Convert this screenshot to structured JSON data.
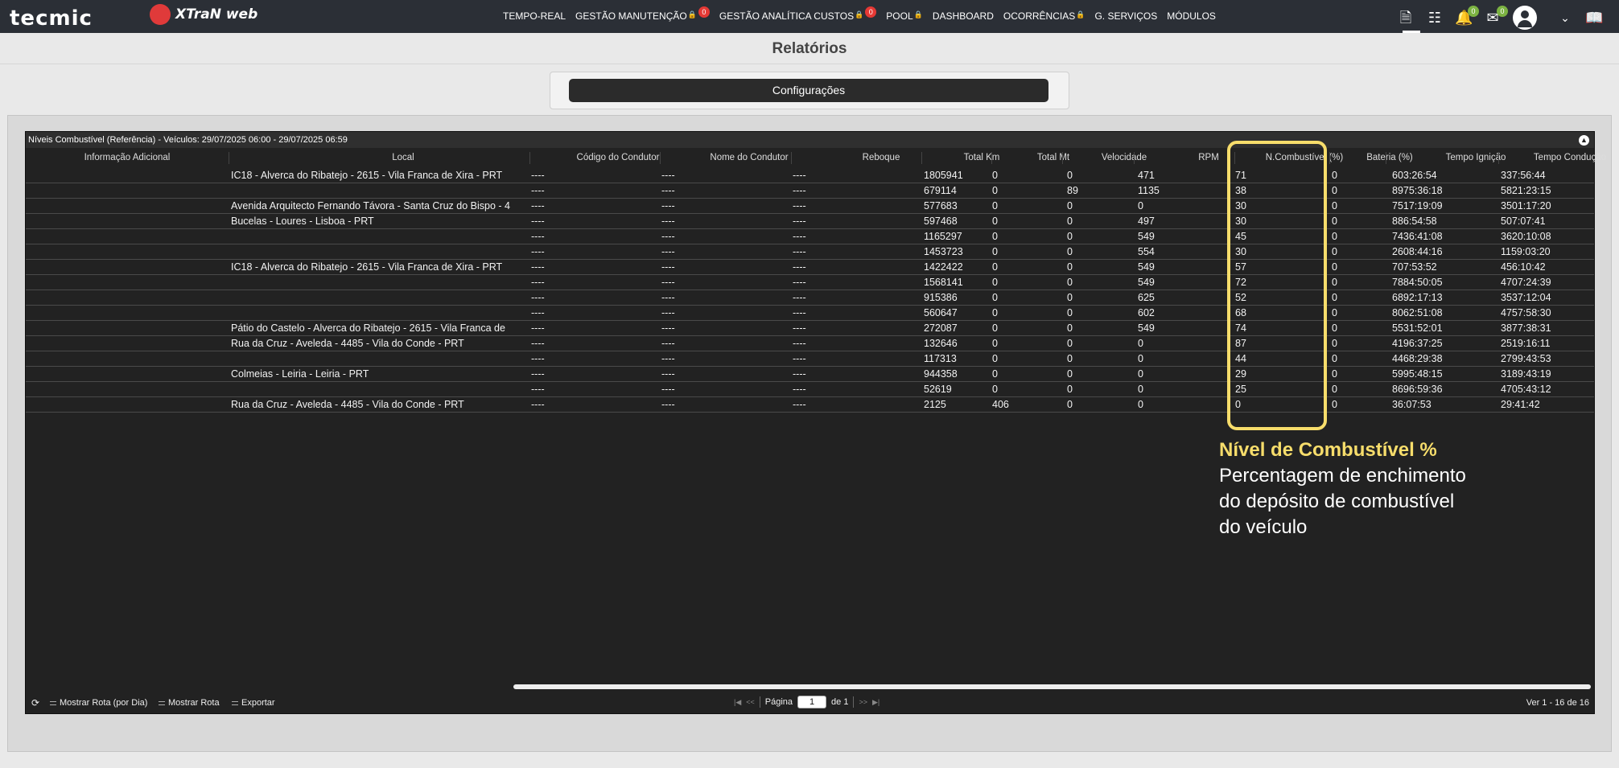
{
  "brand": {
    "logo": "tecmic",
    "product": "XTraN web"
  },
  "nav": [
    {
      "label": "TEMPO-REAL",
      "lock": false,
      "badge": ""
    },
    {
      "label": "GESTÃO MANUTENÇÃO",
      "lock": true,
      "badge": "0"
    },
    {
      "label": "GESTÃO ANALÍTICA CUSTOS",
      "lock": true,
      "badge": "0"
    },
    {
      "label": "POOL",
      "lock": true,
      "badge": ""
    },
    {
      "label": "DASHBOARD",
      "lock": false,
      "badge": ""
    },
    {
      "label": "OCORRÊNCIAS",
      "lock": true,
      "badge": ""
    },
    {
      "label": "G. SERVIÇOS",
      "lock": false,
      "badge": ""
    },
    {
      "label": "MÓDULOS",
      "lock": false,
      "badge": ""
    }
  ],
  "topbar_icons": {
    "document": "document-icon",
    "filters": "sliders-icon",
    "notifications": {
      "icon": "bell-icon",
      "badge": "0"
    },
    "messages": {
      "icon": "mail-icon",
      "badge": "0"
    },
    "user": "user-avatar-icon",
    "dropdown": "chevron-down-icon",
    "manual": "book-icon"
  },
  "page_title": "Relatórios",
  "config_button": "Configurações",
  "grid": {
    "title": "Níveis Combustível (Referência) - Veículos: 29/07/2025 06:00 - 29/07/2025 06:59",
    "columns": [
      "Informação Adicional",
      "Local",
      "Código do Condutor",
      "Nome do Condutor",
      "Reboque",
      "Total Km",
      "Total Mt",
      "Velocidade",
      "RPM",
      "N.Combustível (%)",
      "Bateria (%)",
      "Tempo Ignição",
      "Tempo Condução"
    ],
    "rows": [
      [
        "",
        "IC18 - Alverca do Ribatejo - 2615 - Vila Franca de Xira - PRT",
        "----",
        "----",
        "----",
        "1805941",
        "0",
        "0",
        "471",
        "71",
        "0",
        "603:26:54",
        "337:56:44"
      ],
      [
        "",
        "",
        "----",
        "----",
        "----",
        "679114",
        "0",
        "89",
        "1135",
        "38",
        "0",
        "8975:36:18",
        "5821:23:15"
      ],
      [
        "",
        "Avenida Arquitecto Fernando Távora - Santa Cruz do Bispo - 4",
        "----",
        "----",
        "----",
        "577683",
        "0",
        "0",
        "0",
        "30",
        "0",
        "7517:19:09",
        "3501:17:20"
      ],
      [
        "",
        "Bucelas - Loures - Lisboa - PRT",
        "----",
        "----",
        "----",
        "597468",
        "0",
        "0",
        "497",
        "30",
        "0",
        "886:54:58",
        "507:07:41"
      ],
      [
        "",
        "",
        "----",
        "----",
        "----",
        "1165297",
        "0",
        "0",
        "549",
        "45",
        "0",
        "7436:41:08",
        "3620:10:08"
      ],
      [
        "",
        "",
        "----",
        "----",
        "----",
        "1453723",
        "0",
        "0",
        "554",
        "30",
        "0",
        "2608:44:16",
        "1159:03:20"
      ],
      [
        "",
        "IC18 - Alverca do Ribatejo - 2615 - Vila Franca de Xira - PRT",
        "----",
        "----",
        "----",
        "1422422",
        "0",
        "0",
        "549",
        "57",
        "0",
        "707:53:52",
        "456:10:42"
      ],
      [
        "",
        "",
        "----",
        "----",
        "----",
        "1568141",
        "0",
        "0",
        "549",
        "72",
        "0",
        "7884:50:05",
        "4707:24:39"
      ],
      [
        "",
        "",
        "----",
        "----",
        "----",
        "915386",
        "0",
        "0",
        "625",
        "52",
        "0",
        "6892:17:13",
        "3537:12:04"
      ],
      [
        "",
        "",
        "----",
        "----",
        "----",
        "560647",
        "0",
        "0",
        "602",
        "68",
        "0",
        "8062:51:08",
        "4757:58:30"
      ],
      [
        "",
        "Pátio do Castelo - Alverca do Ribatejo - 2615 - Vila Franca de",
        "----",
        "----",
        "----",
        "272087",
        "0",
        "0",
        "549",
        "74",
        "0",
        "5531:52:01",
        "3877:38:31"
      ],
      [
        "",
        "Rua da Cruz - Aveleda - 4485 - Vila do Conde - PRT",
        "----",
        "----",
        "----",
        "132646",
        "0",
        "0",
        "0",
        "87",
        "0",
        "4196:37:25",
        "2519:16:11"
      ],
      [
        "",
        "",
        "----",
        "----",
        "----",
        "117313",
        "0",
        "0",
        "0",
        "44",
        "0",
        "4468:29:38",
        "2799:43:53"
      ],
      [
        "",
        "Colmeias - Leiria - Leiria - PRT",
        "----",
        "----",
        "----",
        "944358",
        "0",
        "0",
        "0",
        "29",
        "0",
        "5995:48:15",
        "3189:43:19"
      ],
      [
        "",
        "",
        "----",
        "----",
        "----",
        "52619",
        "0",
        "0",
        "0",
        "25",
        "0",
        "8696:59:36",
        "4705:43:12"
      ],
      [
        "",
        "Rua da Cruz - Aveleda - 4485 - Vila do Conde - PRT",
        "----",
        "----",
        "----",
        "2125",
        "406",
        "0",
        "0",
        "0",
        "0",
        "36:07:53",
        "29:41:42"
      ]
    ],
    "footer": {
      "actions": [
        "Mostrar Rota (por Dia)",
        "Mostrar Rota",
        "Exportar"
      ],
      "page_label": "Página",
      "page_value": "1",
      "page_of": "de 1",
      "count": "Ver 1 - 16 de 16"
    }
  },
  "annotation": {
    "title": "Nível de Combustível %",
    "text": "Percentagem de enchimento do depósito de combustível do veículo",
    "color": "#f7dd6b"
  }
}
